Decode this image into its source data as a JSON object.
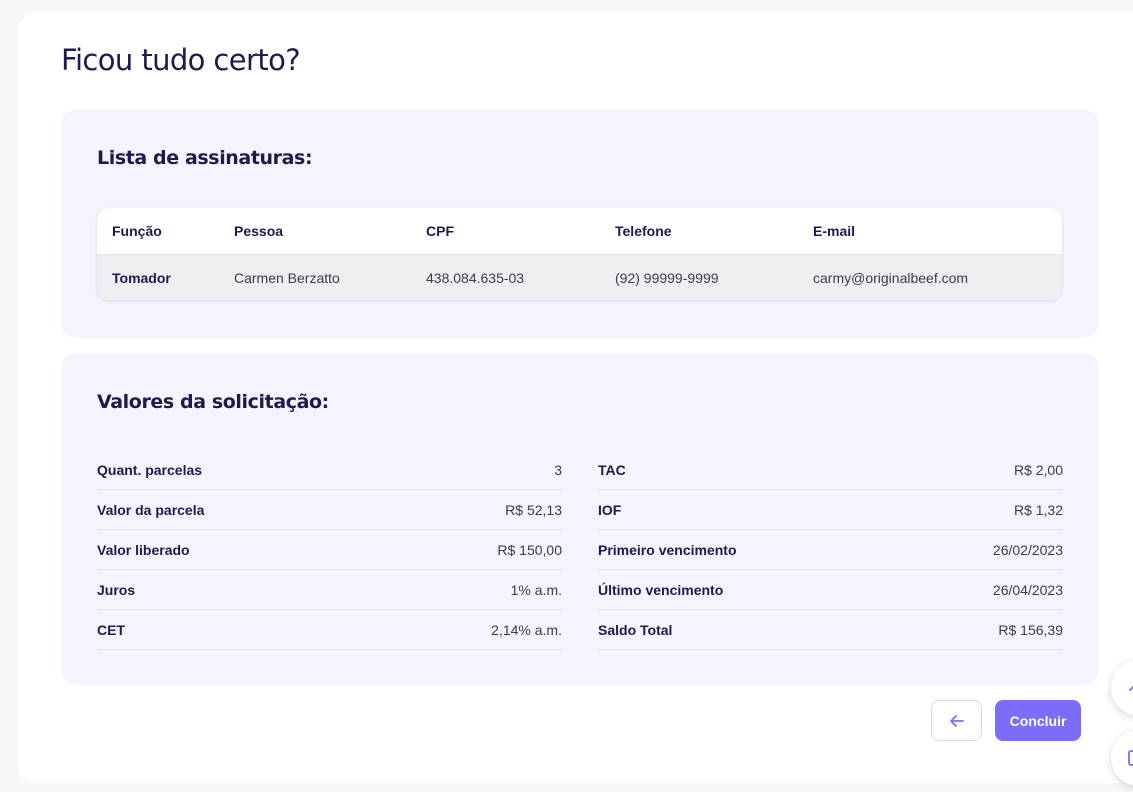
{
  "page": {
    "title": "Ficou tudo certo?"
  },
  "signatures": {
    "title": "Lista de assinaturas:",
    "columns": [
      "Função",
      "Pessoa",
      "CPF",
      "Telefone",
      "E-mail"
    ],
    "rows": [
      [
        "Tomador",
        "Carmen Berzatto",
        "438.084.635-03",
        "(92) 99999-9999",
        "carmy@originalbeef.com"
      ]
    ]
  },
  "values": {
    "title": "Valores da solicitação:",
    "left": [
      {
        "label": "Quant. parcelas",
        "value": "3"
      },
      {
        "label": "Valor da parcela",
        "value": "R$ 52,13"
      },
      {
        "label": "Valor liberado",
        "value": "R$ 150,00"
      },
      {
        "label": "Juros",
        "value": "1% a.m."
      },
      {
        "label": "CET",
        "value": "2,14% a.m."
      }
    ],
    "right": [
      {
        "label": "TAC",
        "value": "R$ 2,00"
      },
      {
        "label": "IOF",
        "value": "R$ 1,32"
      },
      {
        "label": "Primeiro vencimento",
        "value": "26/02/2023"
      },
      {
        "label": "Último vencimento",
        "value": "26/04/2023"
      },
      {
        "label": "Saldo Total",
        "value": "R$ 156,39"
      }
    ]
  },
  "actions": {
    "back_icon": "arrow-left-icon",
    "submit_label": "Concluir"
  },
  "colors": {
    "accent": "#7c6cf8",
    "text": "#1e1a4d",
    "panel": "#f5f3ff"
  }
}
